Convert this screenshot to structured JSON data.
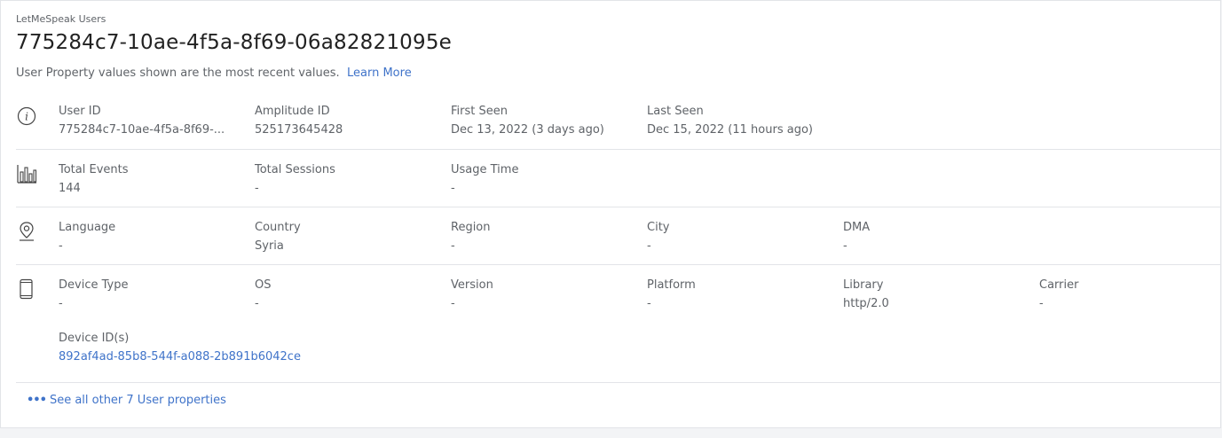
{
  "header": {
    "project": "LetMeSpeak Users",
    "user_title": "775284c7-10ae-4f5a-8f69-06a82821095e",
    "subtitle": "User Property values shown are the most recent values.",
    "learn_more": "Learn More"
  },
  "sections": {
    "identity": {
      "icon": "info-icon",
      "fields": [
        {
          "label": "User ID",
          "value": "775284c7-10ae-4f5a-8f69-..."
        },
        {
          "label": "Amplitude ID",
          "value": "525173645428"
        },
        {
          "label": "First Seen",
          "value": "Dec 13, 2022 (3 days ago)"
        },
        {
          "label": "Last Seen",
          "value": "Dec 15, 2022 (11 hours ago)"
        }
      ]
    },
    "usage": {
      "icon": "bar-chart-icon",
      "fields": [
        {
          "label": "Total Events",
          "value": "144"
        },
        {
          "label": "Total Sessions",
          "value": "-"
        },
        {
          "label": "Usage Time",
          "value": "-"
        }
      ]
    },
    "location": {
      "icon": "location-pin-icon",
      "fields": [
        {
          "label": "Language",
          "value": "-"
        },
        {
          "label": "Country",
          "value": "Syria"
        },
        {
          "label": "Region",
          "value": "-"
        },
        {
          "label": "City",
          "value": "-"
        },
        {
          "label": "DMA",
          "value": "-"
        }
      ]
    },
    "device": {
      "icon": "mobile-device-icon",
      "fields": [
        {
          "label": "Device Type",
          "value": "-"
        },
        {
          "label": "OS",
          "value": "-"
        },
        {
          "label": "Version",
          "value": "-"
        },
        {
          "label": "Platform",
          "value": "-"
        },
        {
          "label": "Library",
          "value": "http/2.0"
        },
        {
          "label": "Carrier",
          "value": "-"
        }
      ],
      "device_ids_label": "Device ID(s)",
      "device_ids_value": "892af4ad-85b8-544f-a088-2b891b6042ce"
    }
  },
  "footer": {
    "see_all": "See all other 7 User properties"
  },
  "colors": {
    "link": "#3f73c9",
    "text_muted": "#5f6368",
    "divider": "#e2e4e8"
  }
}
